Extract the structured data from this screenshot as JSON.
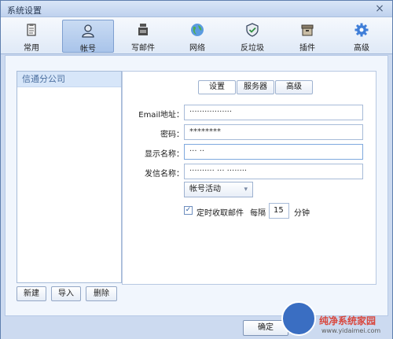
{
  "window": {
    "title": "系统设置"
  },
  "toolbar": {
    "items": [
      {
        "label": "常用",
        "icon": "clipboard-icon"
      },
      {
        "label": "帐号",
        "icon": "user-icon",
        "active": true
      },
      {
        "label": "写邮件",
        "icon": "ink-bottle-icon"
      },
      {
        "label": "网络",
        "icon": "globe-icon"
      },
      {
        "label": "反垃圾",
        "icon": "shield-icon"
      },
      {
        "label": "插件",
        "icon": "box-icon"
      },
      {
        "label": "高级",
        "icon": "gear-icon"
      }
    ]
  },
  "accounts": {
    "items": [
      "信通分公司"
    ],
    "buttons": {
      "new": "新建",
      "import": "导入",
      "delete": "删除"
    }
  },
  "tabs": [
    {
      "label": "设置",
      "active": true
    },
    {
      "label": "服务器"
    },
    {
      "label": "高级"
    }
  ],
  "form": {
    "email_label": "Email地址：",
    "email_value": "·················",
    "password_label": "密码：",
    "password_value": "********",
    "display_name_label": "显示名称：",
    "display_name_value": "··· ··",
    "sender_name_label": "发信名称：",
    "sender_name_value": "·········· ··· ········",
    "account_select": "帐号活动",
    "auto_receive_label": "定时收取邮件",
    "interval_prefix": "每隔",
    "interval_value": "15",
    "interval_unit": "分钟"
  },
  "footer": {
    "ok_label": "确定"
  },
  "watermark": {
    "text": "纯净系统家园",
    "url": "www.yidaimei.com"
  },
  "colors": {
    "active_tab": "#a9c4ea",
    "list_selected": "#d7e6f9",
    "accent": "#2d5da3"
  }
}
